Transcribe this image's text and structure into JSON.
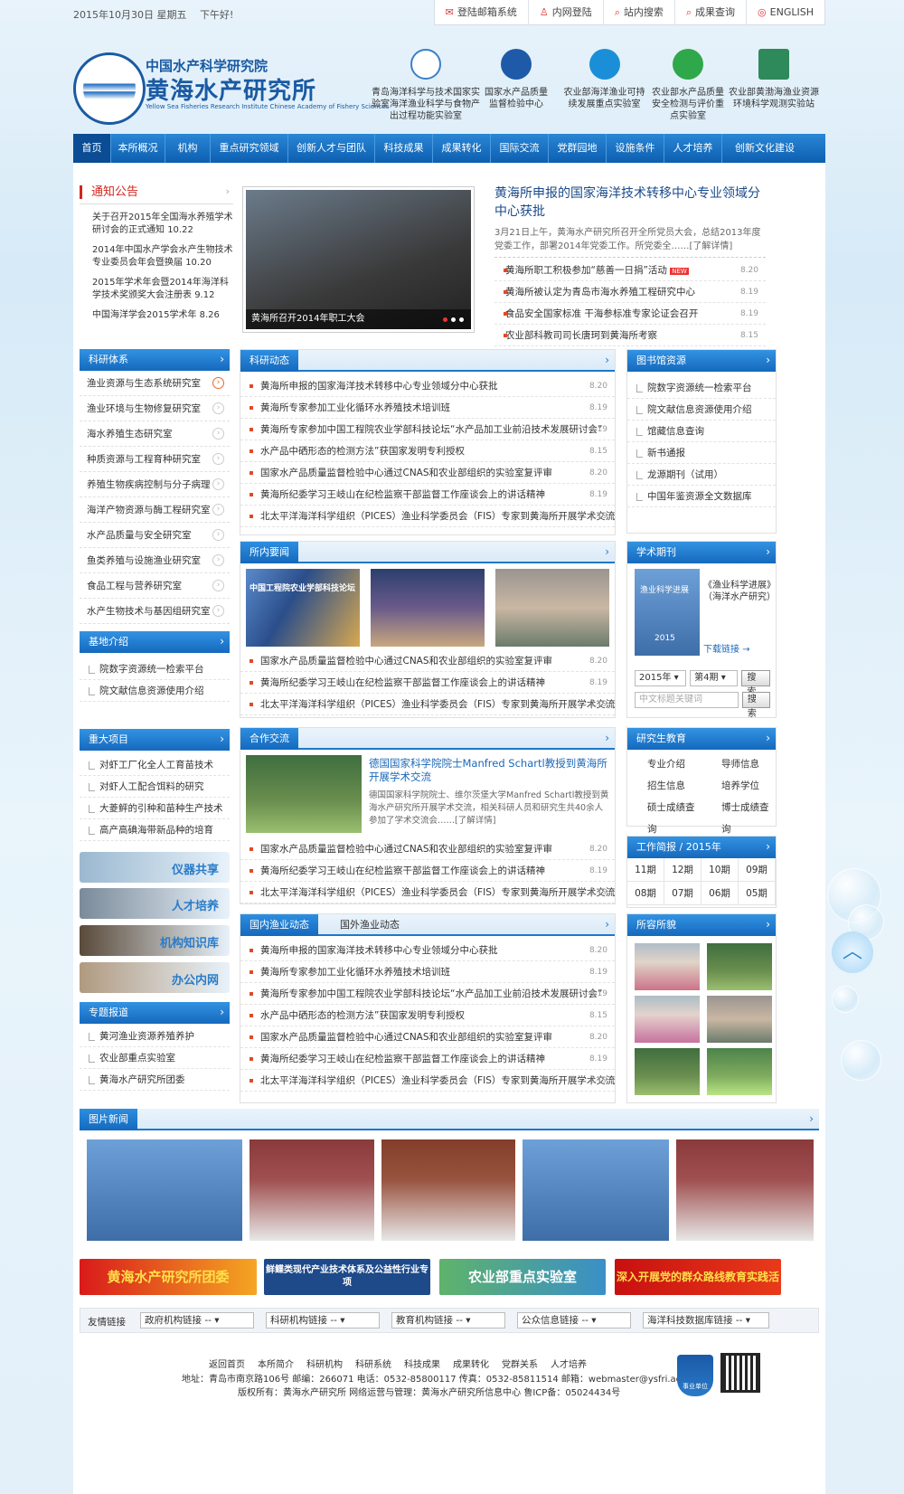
{
  "topbar": {
    "date": "2015年10月30日 星期五　 下午好!",
    "links": [
      "登陆邮箱系统",
      "内网登陆",
      "站内搜索",
      "成果查询",
      "ENGLISH"
    ]
  },
  "header": {
    "cn_small": "中国水产科学研究院",
    "cn_big": "黄海水产研究所",
    "en": "Yellow Sea Fisheries Research Institute Chinese Academy of Fishery Sciences",
    "labs": [
      {
        "name": "青岛海洋科学与技术国家实验室海洋渔业科学与食物产出过程功能实验室",
        "icon": "lab-wave-icon",
        "color": "#3b7fc8"
      },
      {
        "name": "国家水产品质量监督检验中心",
        "icon": "fio-logo-icon",
        "color": "#1e5aa8"
      },
      {
        "name": "农业部海洋渔业可持续发展重点实验室",
        "icon": "globe-icon",
        "color": "#1a8fd8"
      },
      {
        "name": "农业部水产品质量安全检测与评价重点实验室",
        "icon": "lightning-icon",
        "color": "#2ea84a"
      },
      {
        "name": "农业部黄渤海渔业资源环境科学观测实验站",
        "icon": "station-icon",
        "color": "#2e8a5a"
      }
    ]
  },
  "nav": [
    "首页",
    "本所概况",
    "机构",
    "重点研究领域",
    "创新人才与团队",
    "科技成果",
    "成果转化",
    "国际交流",
    "党群园地",
    "设施条件",
    "人才培养",
    "创新文化建设"
  ],
  "notice": {
    "title": "通知公告",
    "items": [
      {
        "t": "关于召开2015年全国海水养殖学术研讨会的正式通知",
        "d": "10.22"
      },
      {
        "t": "2014年中国水产学会水产生物技术专业委员会年会暨换届",
        "d": "10.20"
      },
      {
        "t": "2015年学术年会暨2014年海洋科学技术奖颁奖大会注册表",
        "d": "9.12"
      },
      {
        "t": "中国海洋学会2015学术年",
        "d": "8.26"
      }
    ]
  },
  "focus": {
    "caption": "黄海所召开2014年职工大会",
    "headline": "黄海所申报的国家海洋技术转移中心专业领域分中心获批",
    "summary": "3月21日上午，黄海水产研究所召开全所党员大会，总结2013年度党委工作，部署2014年党委工作。所党委全……",
    "more": "[了解详情]",
    "items": [
      {
        "t": "黄海所职工积极参加“慈善一日捐”活动",
        "d": "8.20",
        "new": "NEW"
      },
      {
        "t": "黄海所被认定为青岛市海水养殖工程研究中心",
        "d": "8.19"
      },
      {
        "t": "食品安全国家标准 干海参标准专家论证会召开",
        "d": "8.19"
      },
      {
        "t": "农业部科教司司长唐珂到黄海所考察",
        "d": "8.15"
      }
    ]
  },
  "research_system": {
    "title": "科研体系",
    "items": [
      "渔业资源与生态系统研究室",
      "渔业环境与生物修复研究室",
      "海水养殖生态研究室",
      "种质资源与工程育种研究室",
      "养殖生物疾病控制与分子病理",
      "海洋产物资源与酶工程研究室",
      "水产品质量与安全研究室",
      "鱼类养殖与设施渔业研究室",
      "食品工程与营养研究室",
      "水产生物技术与基因组研究室"
    ]
  },
  "base_intro": {
    "title": "基地介绍",
    "items": [
      "院数字资源统一检索平台",
      "院文献信息资源使用介绍"
    ]
  },
  "major_projects": {
    "title": "重大项目",
    "items": [
      "对虾工厂化全人工育苗技术",
      "对虾人工配合饵料的研究",
      "大菱鲆的引种和苗种生产技术",
      "高产高碘海带新品种的培育"
    ]
  },
  "quick_buttons": [
    "仪器共享",
    "人才培养",
    "机构知识库",
    "办公内网"
  ],
  "special": {
    "title": "专题报道",
    "items": [
      "黄河渔业资源养殖养护",
      "农业部重点实验室",
      "黄海水产研究所团委"
    ]
  },
  "sci_news": {
    "title": "科研动态",
    "items": [
      {
        "t": "黄海所申报的国家海洋技术转移中心专业领域分中心获批",
        "d": "8.20"
      },
      {
        "t": "黄海所专家参加工业化循环水养殖技术培训班",
        "d": "8.19"
      },
      {
        "t": "黄海所专家参加中国工程院农业学部科技论坛“水产品加工业前沿技术发展研讨会”",
        "d": "8.19"
      },
      {
        "t": "水产品中硒形态的检测方法”获国家发明专利授权",
        "d": "8.15"
      },
      {
        "t": "国家水产品质量监督检验中心通过CNAS和农业部组织的实验室复评审",
        "d": "8.20"
      },
      {
        "t": "黄海所纪委学习王岐山在纪检监察干部监督工作座谈会上的讲话精神",
        "d": "8.19"
      },
      {
        "t": "北太平洋海洋科学组织（PICES）渔业科学委员会（FIS）专家到黄海所开展学术交流",
        "d": "8.19"
      }
    ]
  },
  "inst_news": {
    "title": "所内要闻",
    "photo_text": "中国工程院农业学部科技论坛",
    "items": [
      {
        "t": "国家水产品质量监督检验中心通过CNAS和农业部组织的实验室复评审",
        "d": "8.20"
      },
      {
        "t": "黄海所纪委学习王岐山在纪检监察干部监督工作座谈会上的讲话精神",
        "d": "8.19"
      },
      {
        "t": "北太平洋海洋科学组织（PICES）渔业科学委员会（FIS）专家到黄海所开展学术交流",
        "d": "8.19"
      }
    ]
  },
  "coop": {
    "title": "合作交流",
    "headline": "德国国家科学院院士Manfred Schartl教授到黄海所开展学术交流",
    "summary": "德国国家科学院院士、维尔茨堡大学Manfred Schartl教授到黄海水产研究所开展学术交流，相关科研人员和研究生共40余人参加了学术交流会……",
    "more": "[了解详情]",
    "items": [
      {
        "t": "国家水产品质量监督检验中心通过CNAS和农业部组织的实验室复评审",
        "d": "8.20"
      },
      {
        "t": "黄海所纪委学习王岐山在纪检监察干部监督工作座谈会上的讲话精神",
        "d": "8.19"
      },
      {
        "t": "北太平洋海洋科学组织（PICES）渔业科学委员会（FIS）专家到黄海所开展学术交流",
        "d": "8.19"
      }
    ]
  },
  "fishery": {
    "tab1": "国内渔业动态",
    "tab2": "国外渔业动态",
    "items": [
      {
        "t": "黄海所申报的国家海洋技术转移中心专业领域分中心获批",
        "d": "8.20"
      },
      {
        "t": "黄海所专家参加工业化循环水养殖技术培训班",
        "d": "8.19"
      },
      {
        "t": "黄海所专家参加中国工程院农业学部科技论坛“水产品加工业前沿技术发展研讨会”",
        "d": "8.19"
      },
      {
        "t": "水产品中硒形态的检测方法”获国家发明专利授权",
        "d": "8.15"
      },
      {
        "t": "国家水产品质量监督检验中心通过CNAS和农业部组织的实验室复评审",
        "d": "8.20"
      },
      {
        "t": "黄海所纪委学习王岐山在纪检监察干部监督工作座谈会上的讲话精神",
        "d": "8.19"
      },
      {
        "t": "北太平洋海洋科学组织（PICES）渔业科学委员会（FIS）专家到黄海所开展学术交流",
        "d": "8.19"
      }
    ]
  },
  "library": {
    "title": "图书馆资源",
    "items": [
      "院数字资源统一检索平台",
      "院文献信息资源使用介绍",
      "馆藏信息查询",
      "新书通报",
      "龙源期刊（试用）",
      "中国年鉴资源全文数据库"
    ]
  },
  "journal": {
    "title": "学术期刊",
    "cover_title": "渔业科学进展",
    "cover_year": "2015",
    "name": "《渔业科学进展》（海洋水产研究）",
    "download": "下载链接 →",
    "year": "2015年",
    "issue": "第4期",
    "btn": "搜索",
    "placeholder": "中文标题关键词",
    "btn2": "搜索"
  },
  "grad": {
    "title": "研究生教育",
    "items": [
      "专业介绍",
      "导师信息",
      "招生信息",
      "培养学位",
      "硕士成绩查询",
      "博士成绩查询"
    ]
  },
  "work": {
    "title": "工作简报 / 2015年",
    "items": [
      "11期",
      "12期",
      "10期",
      "09期",
      "08期",
      "07期",
      "06期",
      "05期"
    ]
  },
  "campus": {
    "title": "所容所貌"
  },
  "photo_news": {
    "title": "图片新闻"
  },
  "banners": [
    "黄海水产研究所团委",
    "鲜鲽类现代产业技术体系及公益性行业专项",
    "农业部重点实验室",
    "深入开展党的群众路线教育实践活动"
  ],
  "friend": {
    "label": "友情链接",
    "selects": [
      "政府机构链接 --",
      "科研机构链接 --",
      "教育机构链接 --",
      "公众信息链接 --",
      "海洋科技数据库链接 --"
    ]
  },
  "footer": {
    "links": [
      "返回首页",
      "本所简介",
      "科研机构",
      "科研系统",
      "科技成果",
      "成果转化",
      "党群关系",
      "人才培养"
    ],
    "line1": "地址：青岛市南京路106号  邮编：266071  电话：0532-85800117  传真：0532-85811514  邮箱：webmaster@ysfri.ac.cn",
    "line2": "版权所有：黄海水产研究所    网络运营与管理：黄海水产研究所信息中心  鲁ICP备：05024434号",
    "badge": "事业单位"
  }
}
